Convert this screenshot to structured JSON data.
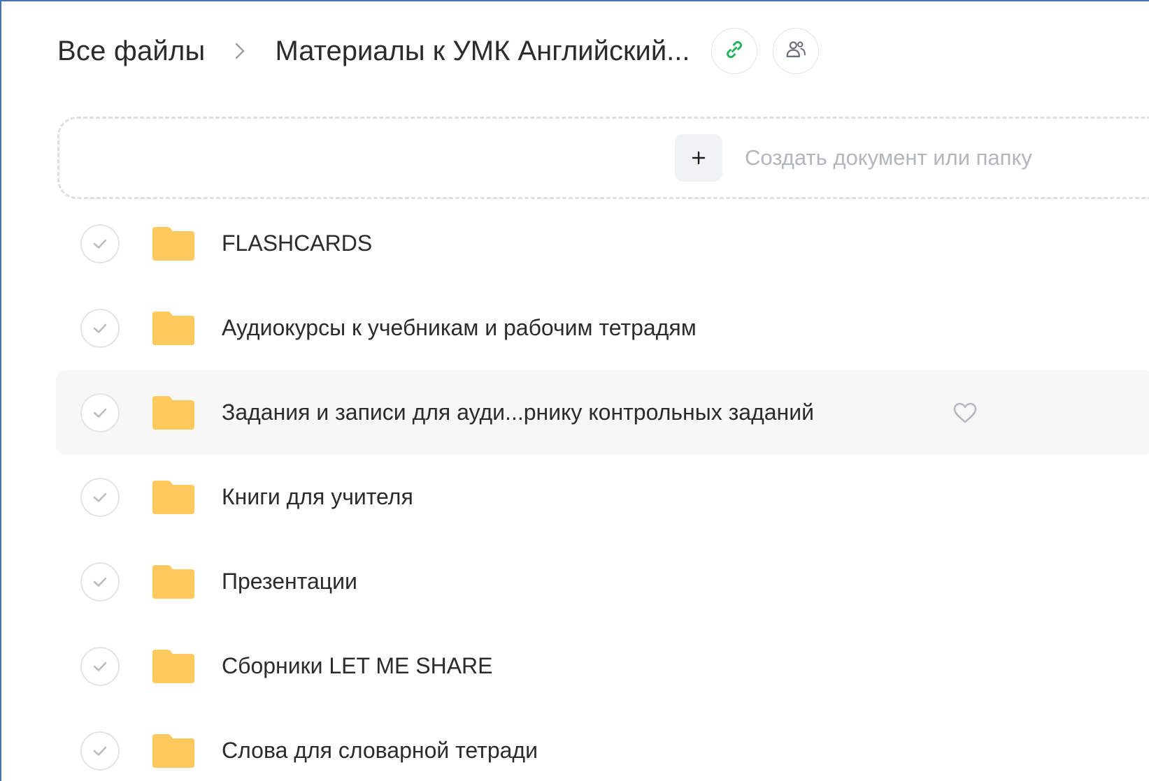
{
  "breadcrumb": {
    "root": "Все файлы",
    "current": "Материалы к УМК Английский..."
  },
  "icons": {
    "separator": "chevron-right-icon",
    "link": "link-icon",
    "share": "people-icon",
    "plus": "plus-icon",
    "check": "check-icon",
    "folder": "folder-icon",
    "favorite": "heart-icon"
  },
  "colors": {
    "accent_green": "#21b35a",
    "folder_yellow": "#ffc95e",
    "frame_border": "#4a72b8"
  },
  "create": {
    "plus_label": "+",
    "label": "Создать документ или папку"
  },
  "items": [
    {
      "name": "FLASHCARDS"
    },
    {
      "name": "Аудиокурсы к учебникам и рабочим тетрадям"
    },
    {
      "name": "Задания и записи для ауди...рнику контрольных заданий"
    },
    {
      "name": "Книги для учителя"
    },
    {
      "name": "Презентации"
    },
    {
      "name": "Сборники LET ME SHARE"
    },
    {
      "name": "Слова для словарной тетради"
    }
  ]
}
